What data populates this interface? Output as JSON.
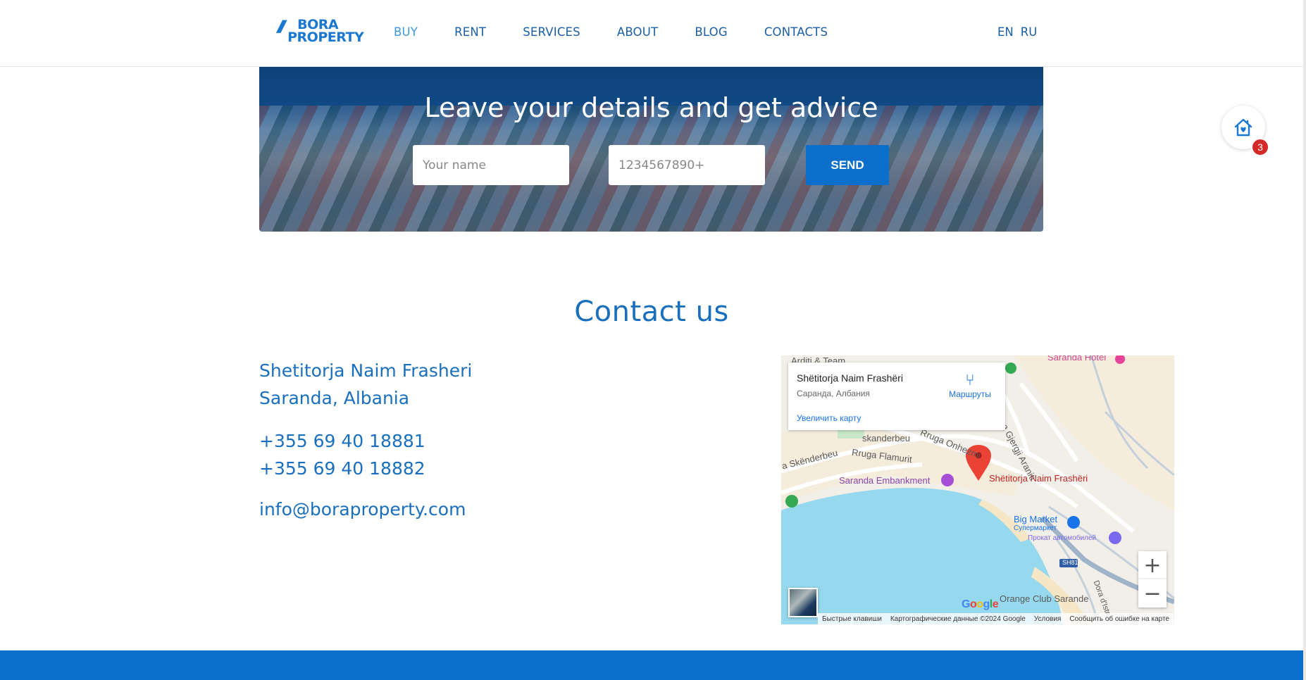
{
  "header": {
    "logo_line1": "BORA",
    "logo_line2": "PROPERTY",
    "nav": [
      {
        "label": "BUY"
      },
      {
        "label": "RENT"
      },
      {
        "label": "SERVICES"
      },
      {
        "label": "ABOUT"
      },
      {
        "label": "BLOG"
      },
      {
        "label": "CONTACTS"
      }
    ],
    "lang": [
      "EN",
      "RU"
    ]
  },
  "hero": {
    "title": "Leave your details and get advice",
    "name_placeholder": "Your name",
    "phone_placeholder": "1234567890+",
    "send_label": "SEND"
  },
  "favorites": {
    "count": "3"
  },
  "contact": {
    "title": "Contact us",
    "address_line1": "Shetitorja Naim Frasheri",
    "address_line2": "Saranda, Albania",
    "phone1": "+355 69 40 18881",
    "phone2": "+355 69 40 18882",
    "email": "info@boraproperty.com"
  },
  "map": {
    "info_title": "Shëtitorja Naim Frashëri",
    "info_sub": "Саранда, Албания",
    "info_link": "Увеличить карту",
    "route_label": "Маршруты",
    "pin_label": "Shëtitorja Naim Frashëri",
    "labels": {
      "arditi": "Arditi & Team",
      "saranda_hotel": "Saranda Hotel",
      "skanderbeu": "skanderbeu",
      "rruga_onhezmi": "Rruga Onhezmi",
      "rruga_flamurit": "Rruga Flamurit",
      "skenderbeu": "a Skënderbeu",
      "embankment": "Saranda Embankment",
      "big_market": "Big Market",
      "supermarket": "Супермаркет",
      "car_rental": "Прокат автомобилей",
      "sh81": "SH81",
      "orange_club": "Orange Club Sarande",
      "rruga_gjergji": "Rruga Gjergji Araniti",
      "dora": "Dora d'Istri"
    },
    "zoom_in": "+",
    "zoom_out": "−",
    "google": "Google",
    "attribution": [
      "Быстрые клавиши",
      "Картографические данные ©2024 Google",
      "Условия",
      "Сообщить об ошибке на карте"
    ]
  }
}
